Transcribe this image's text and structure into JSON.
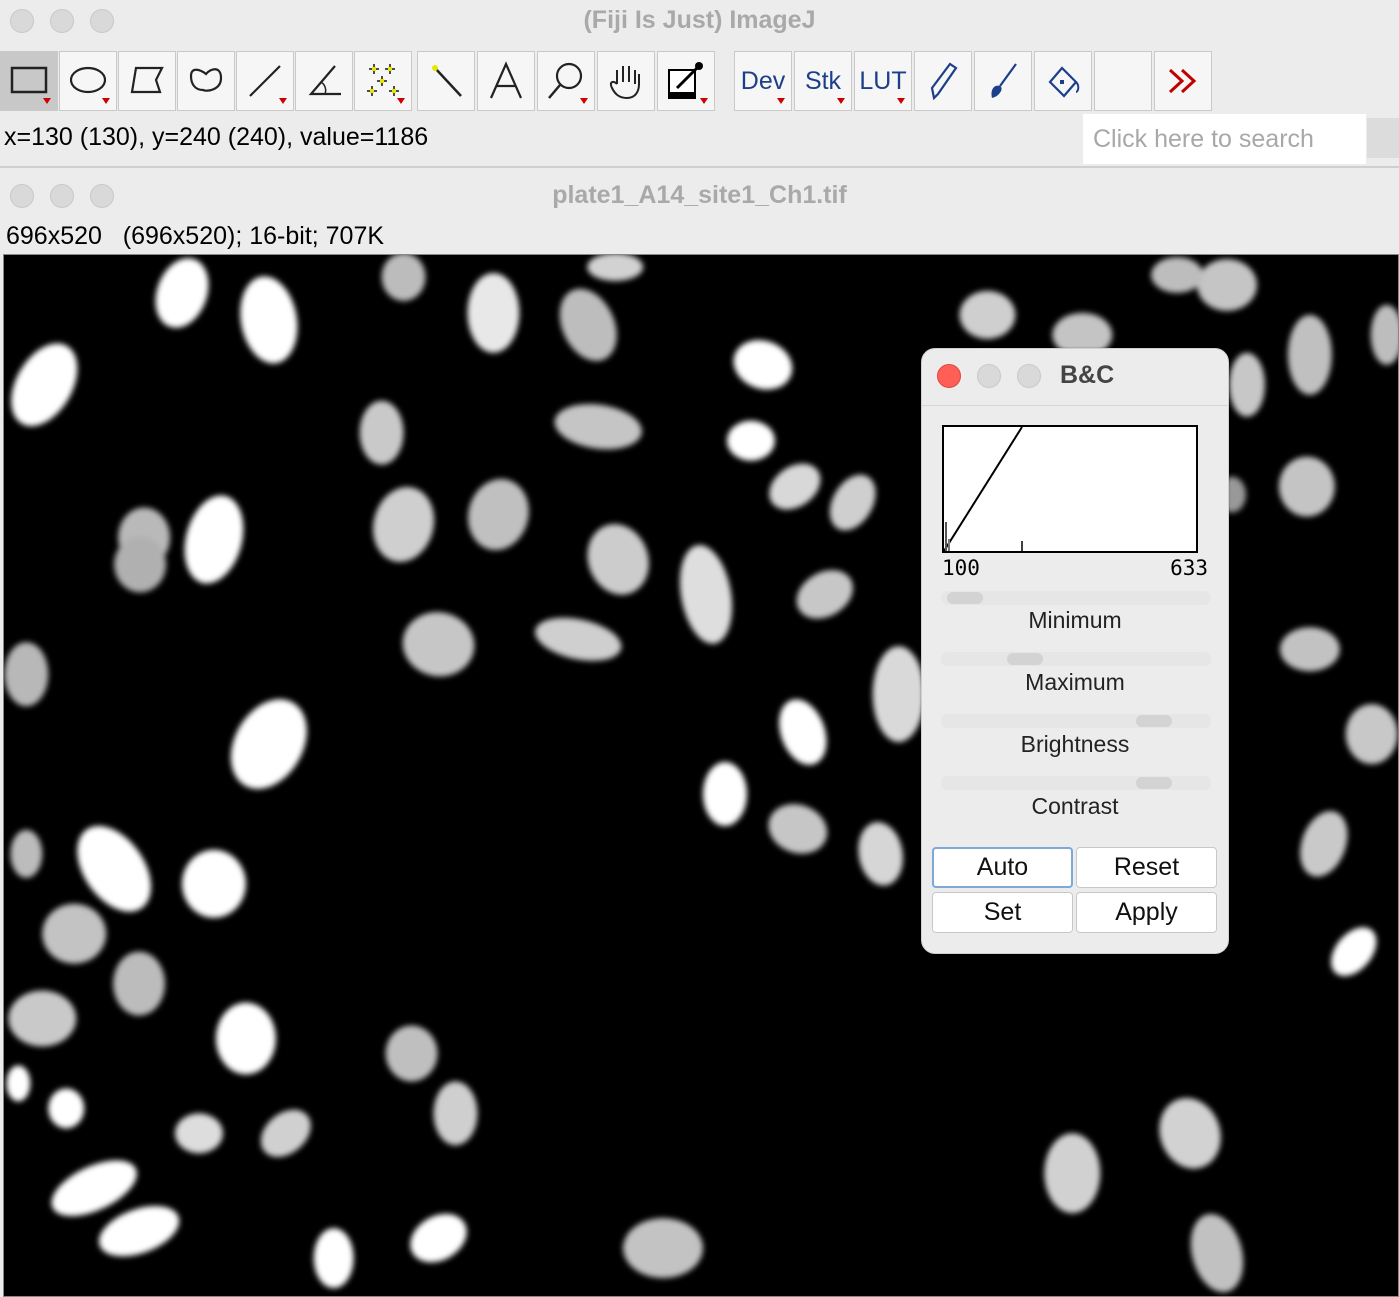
{
  "main_window": {
    "title": "(Fiji Is Just) ImageJ",
    "status_text": "x=130 (130), y=240 (240), value=1186",
    "search": {
      "placeholder": "Click here to search"
    },
    "toolbar": [
      {
        "name": "rectangle-tool",
        "icon": "rectangle-icon",
        "selected": true
      },
      {
        "name": "oval-tool",
        "icon": "oval-icon"
      },
      {
        "name": "polygon-tool",
        "icon": "polygon-icon"
      },
      {
        "name": "freehand-tool",
        "icon": "freehand-icon"
      },
      {
        "name": "line-tool",
        "icon": "line-icon"
      },
      {
        "name": "angle-tool",
        "icon": "angle-icon"
      },
      {
        "name": "multipoint-tool",
        "icon": "multipoint-icon"
      },
      {
        "name": "wand-tool",
        "icon": "wand-icon"
      },
      {
        "name": "text-tool",
        "icon": "text-icon"
      },
      {
        "name": "magnifier-tool",
        "icon": "magnifier-icon"
      },
      {
        "name": "hand-tool",
        "icon": "hand-icon"
      },
      {
        "name": "color-picker-tool",
        "icon": "color-picker-icon"
      },
      {
        "name": "dev-menu",
        "label": "Dev"
      },
      {
        "name": "stk-menu",
        "label": "Stk"
      },
      {
        "name": "lut-menu",
        "label": "LUT"
      },
      {
        "name": "pencil-tool",
        "icon": "pencil-icon"
      },
      {
        "name": "brush-tool",
        "icon": "brush-icon"
      },
      {
        "name": "flood-fill-tool",
        "icon": "flood-fill-icon"
      },
      {
        "name": "empty-slot",
        "icon": ""
      },
      {
        "name": "more-tools",
        "icon": "double-chevron-icon"
      }
    ]
  },
  "image_window": {
    "title": "plate1_A14_site1_Ch1.tif",
    "info": "696x520   (696x520); 16-bit; 707K"
  },
  "bc_dialog": {
    "title": "B&C",
    "range_min": "100",
    "range_max": "633",
    "sliders": [
      {
        "label": "Minimum",
        "value_fraction": 0.0
      },
      {
        "label": "Maximum",
        "value_fraction": 0.27
      },
      {
        "label": "Brightness",
        "value_fraction": 0.85
      },
      {
        "label": "Contrast",
        "value_fraction": 0.85
      }
    ],
    "buttons": {
      "auto": "Auto",
      "reset": "Reset",
      "set": "Set",
      "apply": "Apply"
    }
  },
  "colors": {
    "close_red": "#ff5f57",
    "toolbar_blue": "#1d3f8a",
    "menu_arrow_red": "#cc0000"
  }
}
